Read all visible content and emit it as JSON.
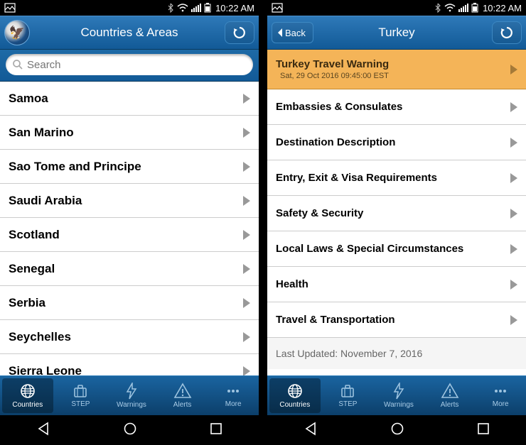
{
  "status": {
    "time": "10:22 AM"
  },
  "left": {
    "title": "Countries & Areas",
    "search_placeholder": "Search",
    "countries": [
      "Samoa",
      "San Marino",
      "Sao Tome and Principe",
      "Saudi Arabia",
      "Scotland",
      "Senegal",
      "Serbia",
      "Seychelles",
      "Sierra Leone"
    ]
  },
  "right": {
    "back_label": "Back",
    "title": "Turkey",
    "warning": {
      "title": "Turkey Travel Warning",
      "sub": "Sat, 29 Oct 2016 09:45:00 EST"
    },
    "sections": [
      "Embassies & Consulates",
      "Destination Description",
      "Entry, Exit & Visa Requirements",
      "Safety & Security",
      "Local Laws & Special Circumstances",
      "Health",
      "Travel & Transportation"
    ],
    "last_updated": "Last Updated: November 7, 2016"
  },
  "tabs": {
    "countries": "Countries",
    "step": "STEP",
    "warnings": "Warnings",
    "alerts": "Alerts",
    "more": "More"
  }
}
